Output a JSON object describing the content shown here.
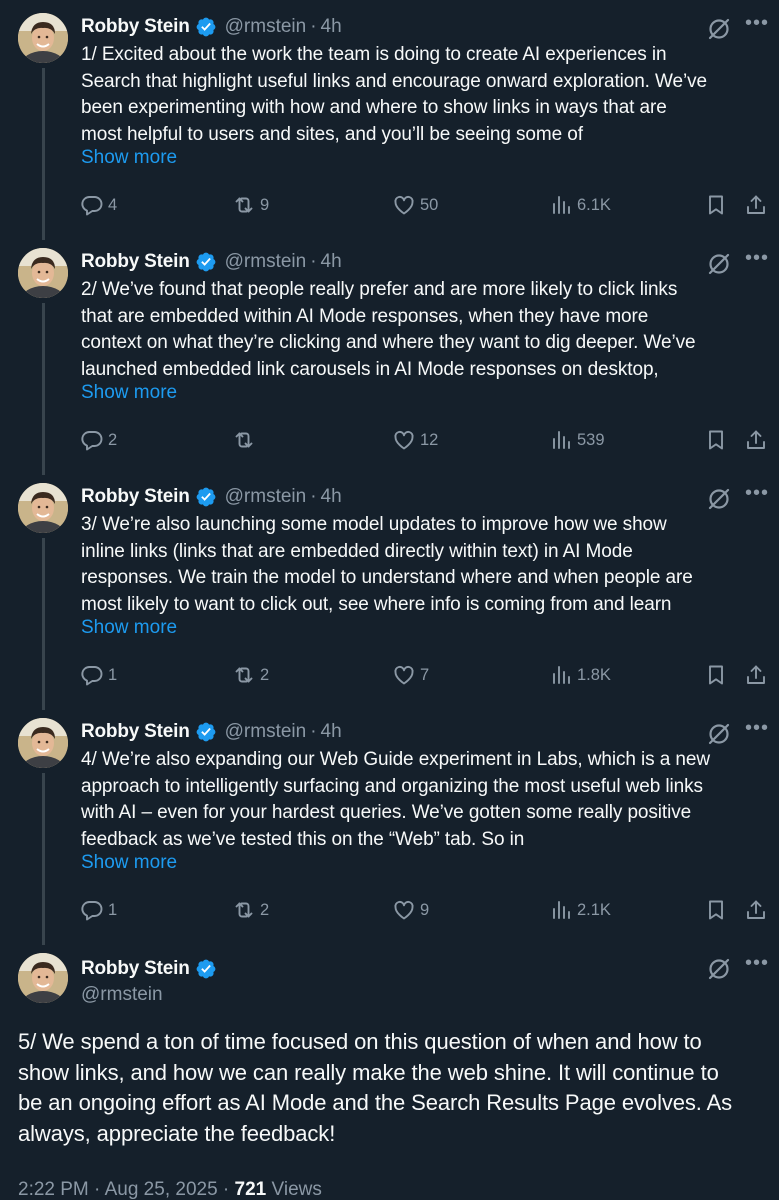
{
  "colors": {
    "background": "#15202b",
    "text": "#f7f9f9",
    "secondary": "#8b98a5",
    "link": "#1d9bf0",
    "verified": "#1d9bf0",
    "thread_line": "#38444d"
  },
  "author": {
    "name": "Robby Stein",
    "handle": "@rmstein",
    "separator": "·",
    "verified_icon": "verified-badge-icon"
  },
  "show_more_label": "Show more",
  "tweets": [
    {
      "time": "4h",
      "lines": [
        "1/ Excited about the work the team is doing to create AI experiences in",
        "Search that highlight useful links and encourage onward exploration. We’ve",
        "been experimenting with how and where to show links in ways that are",
        "most helpful to users and sites, and you’ll be seeing some of"
      ],
      "replies": "4",
      "retweets": "9",
      "likes": "50",
      "views": "6.1K"
    },
    {
      "time": "4h",
      "lines": [
        "2/ We’ve found that people really prefer and are more likely to click links",
        "that are embedded within AI Mode responses, when they have more",
        "context on what they’re clicking and where they want to dig deeper. We’ve",
        "launched embedded link carousels in AI Mode responses on desktop,"
      ],
      "replies": "2",
      "retweets": "",
      "likes": "12",
      "views": "539"
    },
    {
      "time": "4h",
      "lines": [
        "3/ We’re also launching some model updates to improve how we show",
        "inline links (links that are embedded directly within text) in AI Mode",
        "responses. We train the model to understand where and when people are",
        "most likely to want to click out, see where info is coming from and learn"
      ],
      "replies": "1",
      "retweets": "2",
      "likes": "7",
      "views": "1.8K"
    },
    {
      "time": "4h",
      "lines": [
        "4/ We’re also expanding our Web Guide experiment in Labs, which is a new",
        "approach to intelligently surfacing and organizing the most useful web links",
        "with AI – even for your hardest queries. We’ve gotten some really positive",
        "feedback as we’ve tested this on the “Web” tab. So in"
      ],
      "replies": "1",
      "retweets": "2",
      "likes": "9",
      "views": "2.1K"
    }
  ],
  "main_tweet": {
    "lines": [
      "5/ We spend a ton of time focused on this question of when and how to",
      "show links, and how we can really make the web shine. It will continue to",
      "be an ongoing effort as AI Mode and the Search Results Page evolves. As",
      "always, appreciate the feedback!"
    ],
    "timestamp": "2:22 PM · Aug 25, 2025 · ",
    "view_count": "721",
    "views_label": " Views"
  }
}
